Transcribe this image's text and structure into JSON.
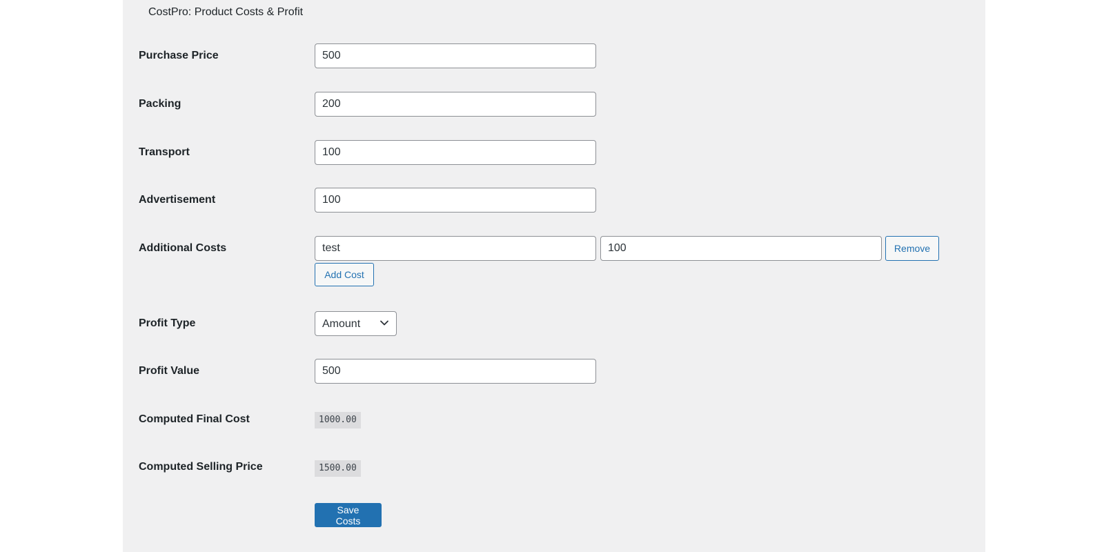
{
  "panel": {
    "title": "CostPro: Product Costs & Profit"
  },
  "fields": {
    "purchase_price": {
      "label": "Purchase Price",
      "value": "500"
    },
    "packing": {
      "label": "Packing",
      "value": "200"
    },
    "transport": {
      "label": "Transport",
      "value": "100"
    },
    "advertisement": {
      "label": "Advertisement",
      "value": "100"
    },
    "additional_costs": {
      "label": "Additional Costs",
      "items": [
        {
          "name": "test",
          "amount": "100"
        }
      ],
      "remove_label": "Remove",
      "add_label": "Add Cost"
    },
    "profit_type": {
      "label": "Profit Type",
      "selected": "Amount"
    },
    "profit_value": {
      "label": "Profit Value",
      "value": "500"
    },
    "computed_final_cost": {
      "label": "Computed Final Cost",
      "value": "1000.00"
    },
    "computed_selling_price": {
      "label": "Computed Selling Price",
      "value": "1500.00"
    }
  },
  "actions": {
    "save_label": "Save Costs"
  },
  "colors": {
    "panel_background": "#f0f0f1",
    "accent": "#2271b1",
    "input_border": "#8c8f94",
    "code_background": "#dcdcde"
  },
  "icons": {
    "select_chevron": "chevron-down-icon"
  }
}
